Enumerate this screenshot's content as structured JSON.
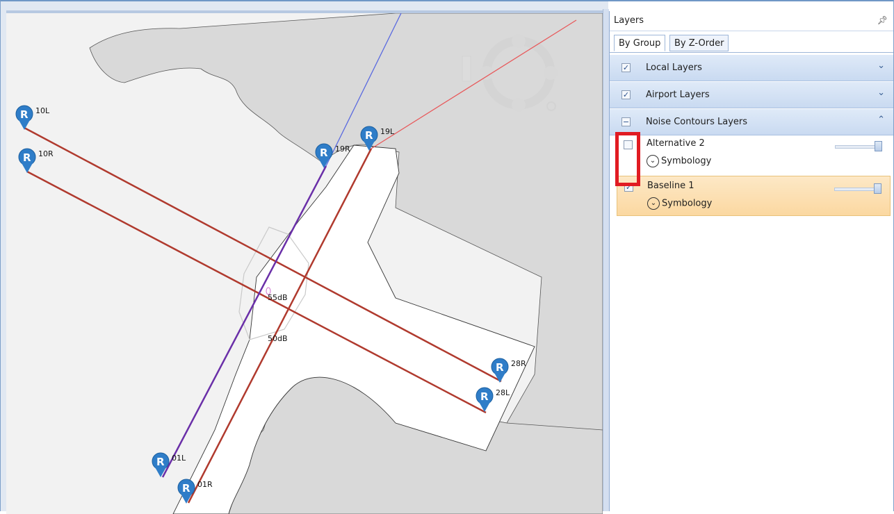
{
  "panel": {
    "title": "Layers",
    "pin_icon": "pin-icon",
    "tabs": [
      {
        "label": "By Group",
        "active": true
      },
      {
        "label": "By Z-Order",
        "active": false
      }
    ],
    "groups": [
      {
        "label": "Local Layers",
        "checked": true,
        "expanded": false
      },
      {
        "label": "Airport Layers",
        "checked": true,
        "expanded": false
      },
      {
        "label": "Noise Contours Layers",
        "checked": "partial",
        "expanded": true
      }
    ],
    "layers": [
      {
        "name": "Alternative 2",
        "checked": false,
        "symbology_label": "Symbology",
        "opacity": 1.0,
        "selected": false
      },
      {
        "name": "Baseline 1",
        "checked": true,
        "symbology_label": "Symbology",
        "opacity": 1.0,
        "selected": true
      }
    ]
  },
  "map": {
    "runway_labels": [
      "10L",
      "10R",
      "19R",
      "19L",
      "28R",
      "28L",
      "01L",
      "01R"
    ],
    "contour_labels": [
      "55dB",
      "50dB"
    ],
    "marker_glyph": "R",
    "colors": {
      "runway": "#b03a2e",
      "runway_alt": "#6a2fa8",
      "flight_track_blue": "#5a6ae0",
      "flight_track_red": "#e8585a",
      "marker": "#2f7dc8",
      "land": "#d9d9d9",
      "airport_area": "#ffffff",
      "highlight": "#e11b22"
    }
  }
}
